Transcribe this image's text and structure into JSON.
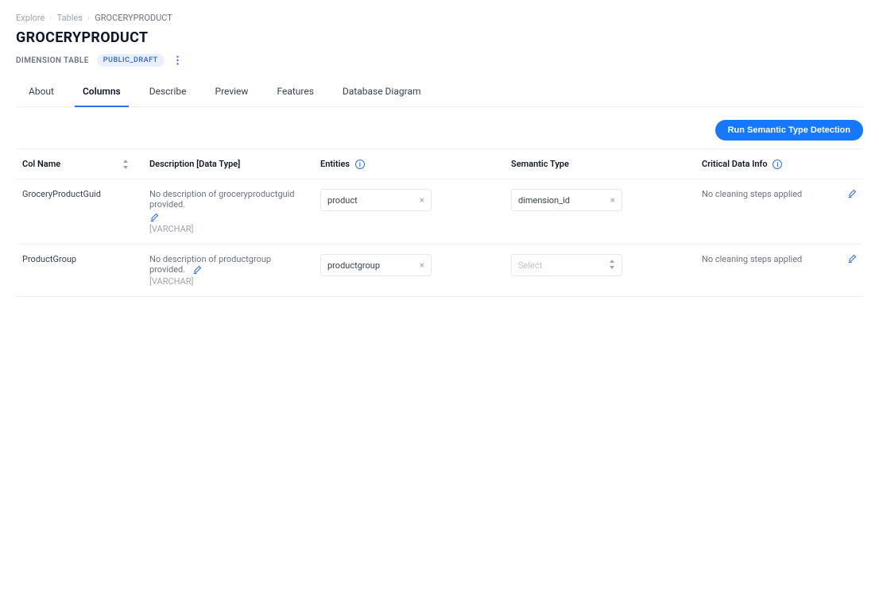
{
  "breadcrumb": {
    "explore": "Explore",
    "tables": "Tables",
    "current": "GROCERYPRODUCT"
  },
  "header": {
    "title": "GROCERYPRODUCT",
    "subtype": "DIMENSION TABLE",
    "badge": "PUBLIC_DRAFT"
  },
  "tabs": {
    "about": "About",
    "columns": "Columns",
    "describe": "Describe",
    "preview": "Preview",
    "features": "Features",
    "diagram": "Database Diagram"
  },
  "actions": {
    "run_detection": "Run Semantic Type Detection"
  },
  "table_headers": {
    "colname": "Col Name",
    "description": "Description [Data Type]",
    "entities": "Entities",
    "semantic_type": "Semantic Type",
    "critical": "Critical Data Info"
  },
  "rows": [
    {
      "name": "GroceryProductGuid",
      "description": "No description of groceryproductguid provided.",
      "datatype": "[VARCHAR]",
      "entity": "product",
      "semantic_type": "dimension_id",
      "semantic_is_select_placeholder": false,
      "critical": "No cleaning steps applied"
    },
    {
      "name": "ProductGroup",
      "description": "No description of productgroup provided.",
      "datatype": "[VARCHAR]",
      "entity": "productgroup",
      "semantic_type": "Select",
      "semantic_is_select_placeholder": true,
      "critical": "No cleaning steps applied"
    }
  ]
}
